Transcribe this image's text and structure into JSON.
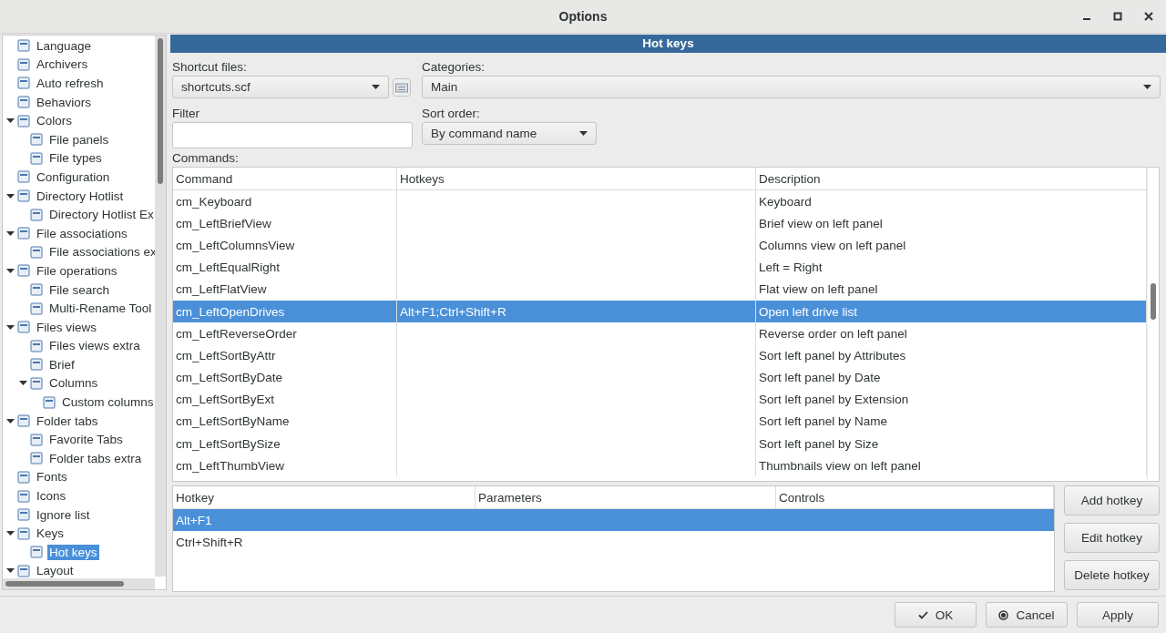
{
  "window": {
    "title": "Options"
  },
  "tree": [
    {
      "label": "Language",
      "selected": false
    },
    {
      "label": "Archivers",
      "selected": false
    },
    {
      "label": "Auto refresh",
      "selected": false
    },
    {
      "label": "Behaviors",
      "selected": false
    },
    {
      "label": "Colors",
      "selected": false,
      "expanded": true,
      "children": [
        {
          "label": "File panels",
          "selected": false
        },
        {
          "label": "File types",
          "selected": false
        }
      ]
    },
    {
      "label": "Configuration",
      "selected": false
    },
    {
      "label": "Directory Hotlist",
      "selected": false,
      "expanded": true,
      "children": [
        {
          "label": "Directory Hotlist Ex",
          "selected": false
        }
      ]
    },
    {
      "label": "File associations",
      "selected": false,
      "expanded": true,
      "children": [
        {
          "label": "File associations ex",
          "selected": false
        }
      ]
    },
    {
      "label": "File operations",
      "selected": false,
      "expanded": true,
      "children": [
        {
          "label": "File search",
          "selected": false
        },
        {
          "label": "Multi-Rename Tool",
          "selected": false
        }
      ]
    },
    {
      "label": "Files views",
      "selected": false,
      "expanded": true,
      "children": [
        {
          "label": "Files views extra",
          "selected": false
        },
        {
          "label": "Brief",
          "selected": false
        },
        {
          "label": "Columns",
          "selected": false,
          "expanded": true,
          "children": [
            {
              "label": "Custom columns",
              "selected": false
            }
          ]
        }
      ]
    },
    {
      "label": "Folder tabs",
      "selected": false,
      "expanded": true,
      "children": [
        {
          "label": "Favorite Tabs",
          "selected": false
        },
        {
          "label": "Folder tabs extra",
          "selected": false
        }
      ]
    },
    {
      "label": "Fonts",
      "selected": false
    },
    {
      "label": "Icons",
      "selected": false
    },
    {
      "label": "Ignore list",
      "selected": false
    },
    {
      "label": "Keys",
      "selected": false,
      "expanded": true,
      "children": [
        {
          "label": "Hot keys",
          "selected": true
        }
      ]
    },
    {
      "label": "Layout",
      "selected": false,
      "expanded": true
    }
  ],
  "header": "Hot keys",
  "shortcut_files": {
    "label": "Shortcut files:",
    "value": "shortcuts.scf"
  },
  "categories": {
    "label": "Categories:",
    "value": "Main"
  },
  "filter": {
    "label": "Filter"
  },
  "sort_order": {
    "label": "Sort order:",
    "value": "By command name"
  },
  "commands": {
    "label": "Commands:",
    "columns": [
      "Command",
      "Hotkeys",
      "Description"
    ],
    "rows": [
      {
        "command": "cm_Keyboard",
        "hotkeys": "",
        "description": "Keyboard",
        "selected": false
      },
      {
        "command": "cm_LeftBriefView",
        "hotkeys": "",
        "description": "Brief view on left panel",
        "selected": false
      },
      {
        "command": "cm_LeftColumnsView",
        "hotkeys": "",
        "description": "Columns view on left panel",
        "selected": false
      },
      {
        "command": "cm_LeftEqualRight",
        "hotkeys": "",
        "description": "Left = Right",
        "selected": false
      },
      {
        "command": "cm_LeftFlatView",
        "hotkeys": "",
        "description": "Flat view on left panel",
        "selected": false
      },
      {
        "command": "cm_LeftOpenDrives",
        "hotkeys": "Alt+F1;Ctrl+Shift+R",
        "description": "Open left drive list",
        "selected": true
      },
      {
        "command": "cm_LeftReverseOrder",
        "hotkeys": "",
        "description": "Reverse order on left panel",
        "selected": false
      },
      {
        "command": "cm_LeftSortByAttr",
        "hotkeys": "",
        "description": "Sort left panel by Attributes",
        "selected": false
      },
      {
        "command": "cm_LeftSortByDate",
        "hotkeys": "",
        "description": "Sort left panel by Date",
        "selected": false
      },
      {
        "command": "cm_LeftSortByExt",
        "hotkeys": "",
        "description": "Sort left panel by Extension",
        "selected": false
      },
      {
        "command": "cm_LeftSortByName",
        "hotkeys": "",
        "description": "Sort left panel by Name",
        "selected": false
      },
      {
        "command": "cm_LeftSortBySize",
        "hotkeys": "",
        "description": "Sort left panel by Size",
        "selected": false
      },
      {
        "command": "cm_LeftThumbView",
        "hotkeys": "",
        "description": "Thumbnails view on left panel",
        "selected": false
      }
    ]
  },
  "hotkeys": {
    "columns": [
      "Hotkey",
      "Parameters",
      "Controls"
    ],
    "rows": [
      {
        "hotkey": "Alt+F1",
        "selected": true
      },
      {
        "hotkey": "Ctrl+Shift+R",
        "selected": false
      }
    ]
  },
  "side_buttons": [
    "Add hotkey",
    "Edit hotkey",
    "Delete hotkey"
  ],
  "buttons": [
    {
      "label": "OK",
      "kind": "ok"
    },
    {
      "label": "Cancel",
      "kind": "cancel"
    },
    {
      "label": "Apply",
      "kind": "plain"
    }
  ]
}
